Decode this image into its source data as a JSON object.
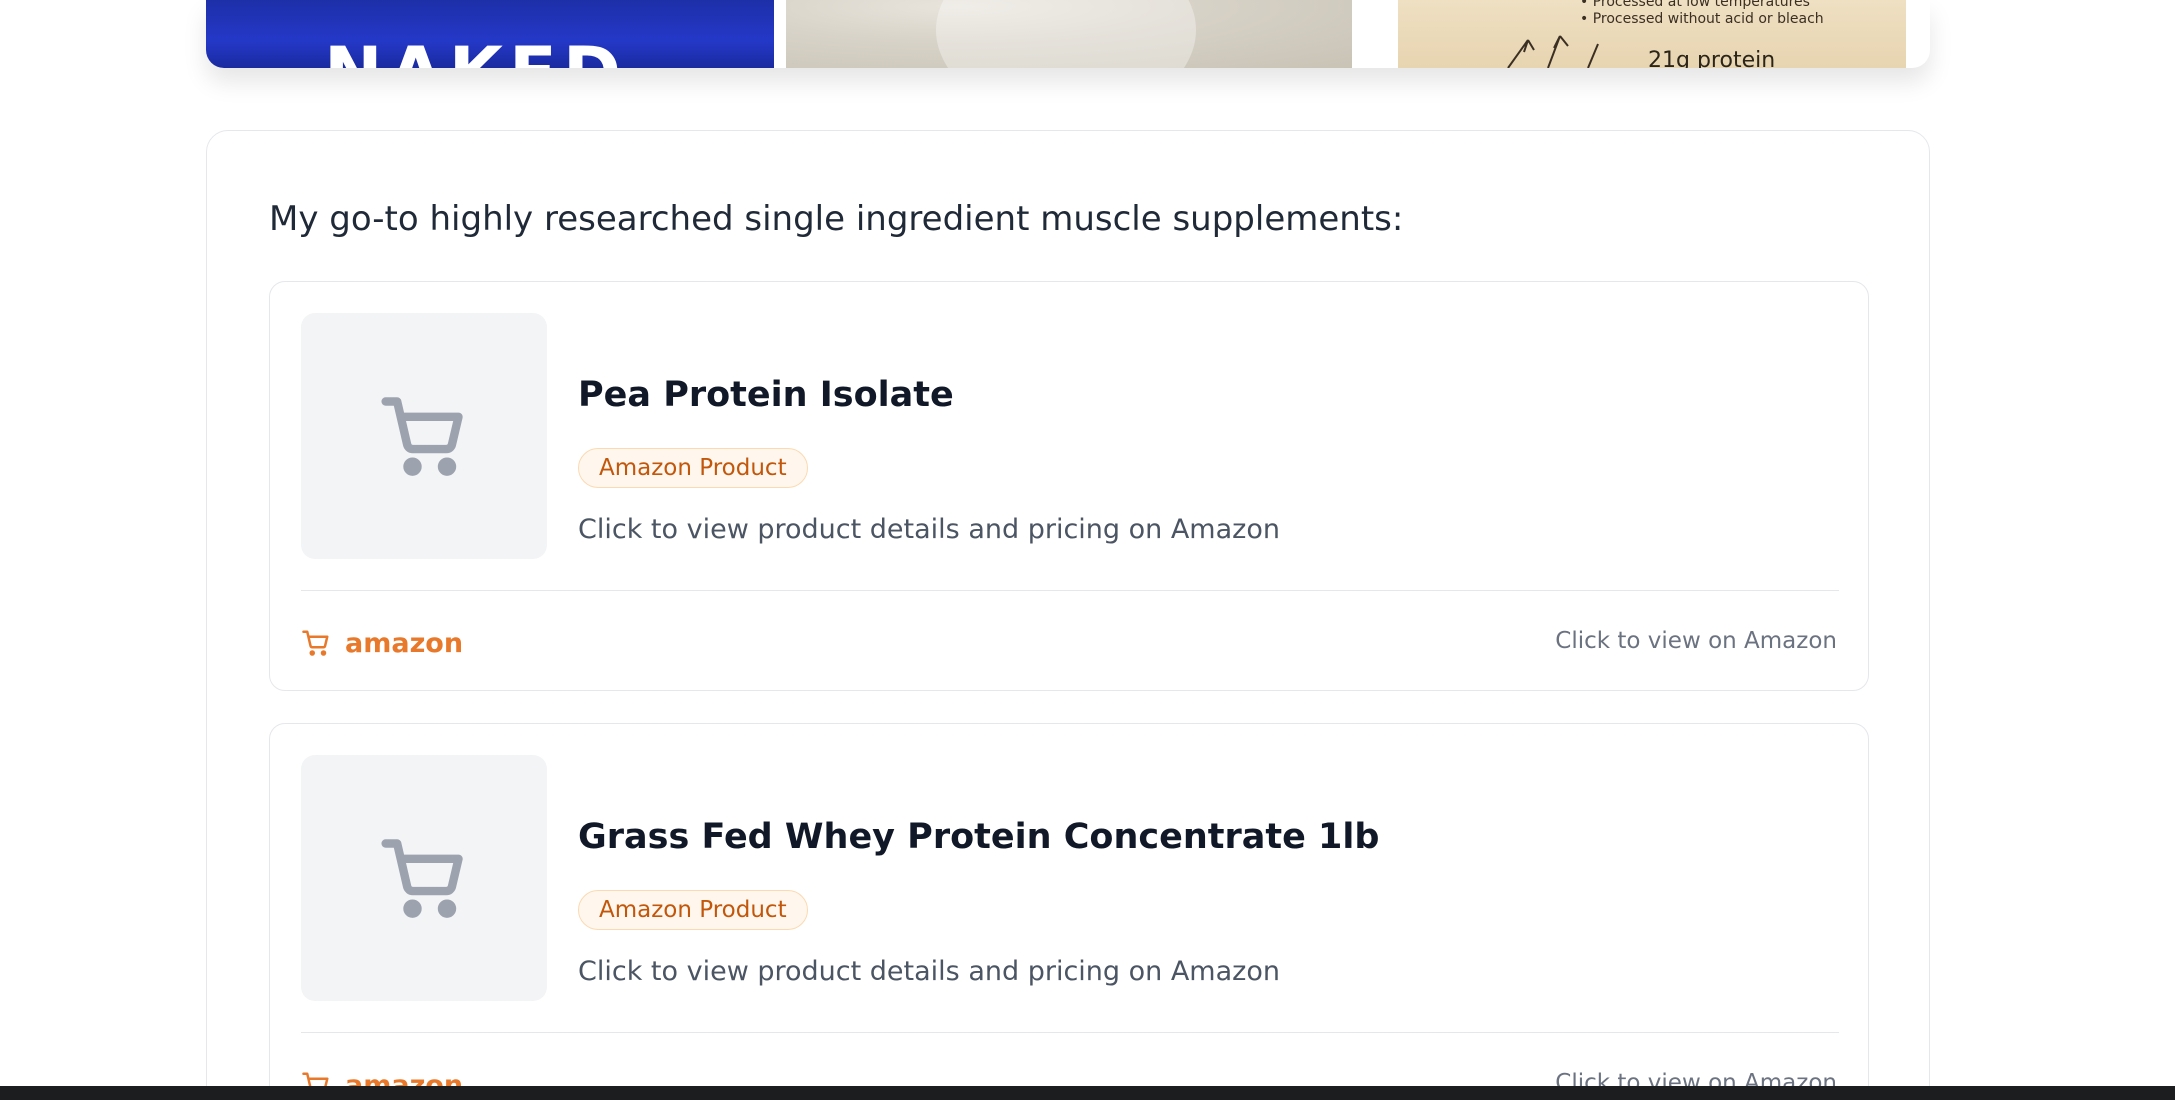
{
  "top_images": {
    "first_image_text": "NAKED",
    "third_image_lines": [
      "• Processed at low temperatures",
      "• Processed without acid or bleach"
    ],
    "third_image_protein": "21g protein"
  },
  "section": {
    "title": "My go-to highly researched single ingredient muscle supplements:"
  },
  "products": [
    {
      "title": "Pea Protein Isolate",
      "badge": "Amazon Product",
      "description": "Click to view product details and pricing on Amazon",
      "store_label": "amazon",
      "view_label": "Click to view on Amazon",
      "thumb_icon": "cart-icon"
    },
    {
      "title": "Grass Fed Whey Protein Concentrate 1lb",
      "badge": "Amazon Product",
      "description": "Click to view product details and pricing on Amazon",
      "store_label": "amazon",
      "view_label": "Click to view on Amazon",
      "thumb_icon": "cart-icon"
    }
  ],
  "colors": {
    "accent_orange": "#e8782a",
    "badge_text": "#c2570c",
    "badge_bg": "#fff7ed",
    "placeholder_bg": "#f3f4f6",
    "cart_gray": "#9ca3af"
  }
}
